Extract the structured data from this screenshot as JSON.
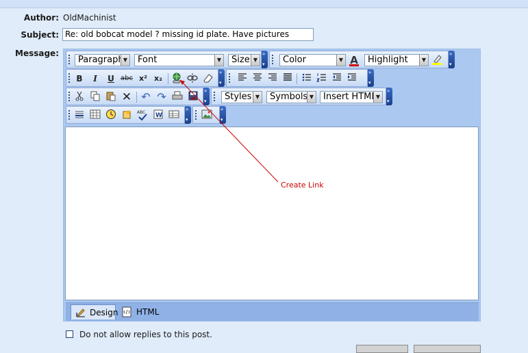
{
  "author": {
    "label": "Author:",
    "value": "OldMachinist"
  },
  "subject": {
    "label": "Subject:",
    "value": "Re: old bobcat model ? missing id plate. Have pictures"
  },
  "message": {
    "label": "Message:"
  },
  "toolbar": {
    "paragraph": "Paragraph",
    "font": "Font",
    "size": "Size",
    "color": "Color",
    "highlight": "Highlight",
    "styles": "Styles",
    "symbols": "Symbols",
    "insert_html": "Insert HTML"
  },
  "icons": {
    "bold": "B",
    "italic": "I",
    "underline": "U",
    "strike": "abc",
    "superscript": "x²",
    "subscript": "x₂",
    "font_color_glyph": "A"
  },
  "annotation": {
    "text": "Create Link",
    "color": "#cc0000"
  },
  "mode_tabs": {
    "design": "Design",
    "html": "HTML"
  },
  "options": {
    "no_replies": "Do not allow replies to this post."
  },
  "colors": {
    "background": "#e0ecfa",
    "toolbar_accent": "#1b3f8a",
    "editor_frame": "#aac8f0"
  }
}
